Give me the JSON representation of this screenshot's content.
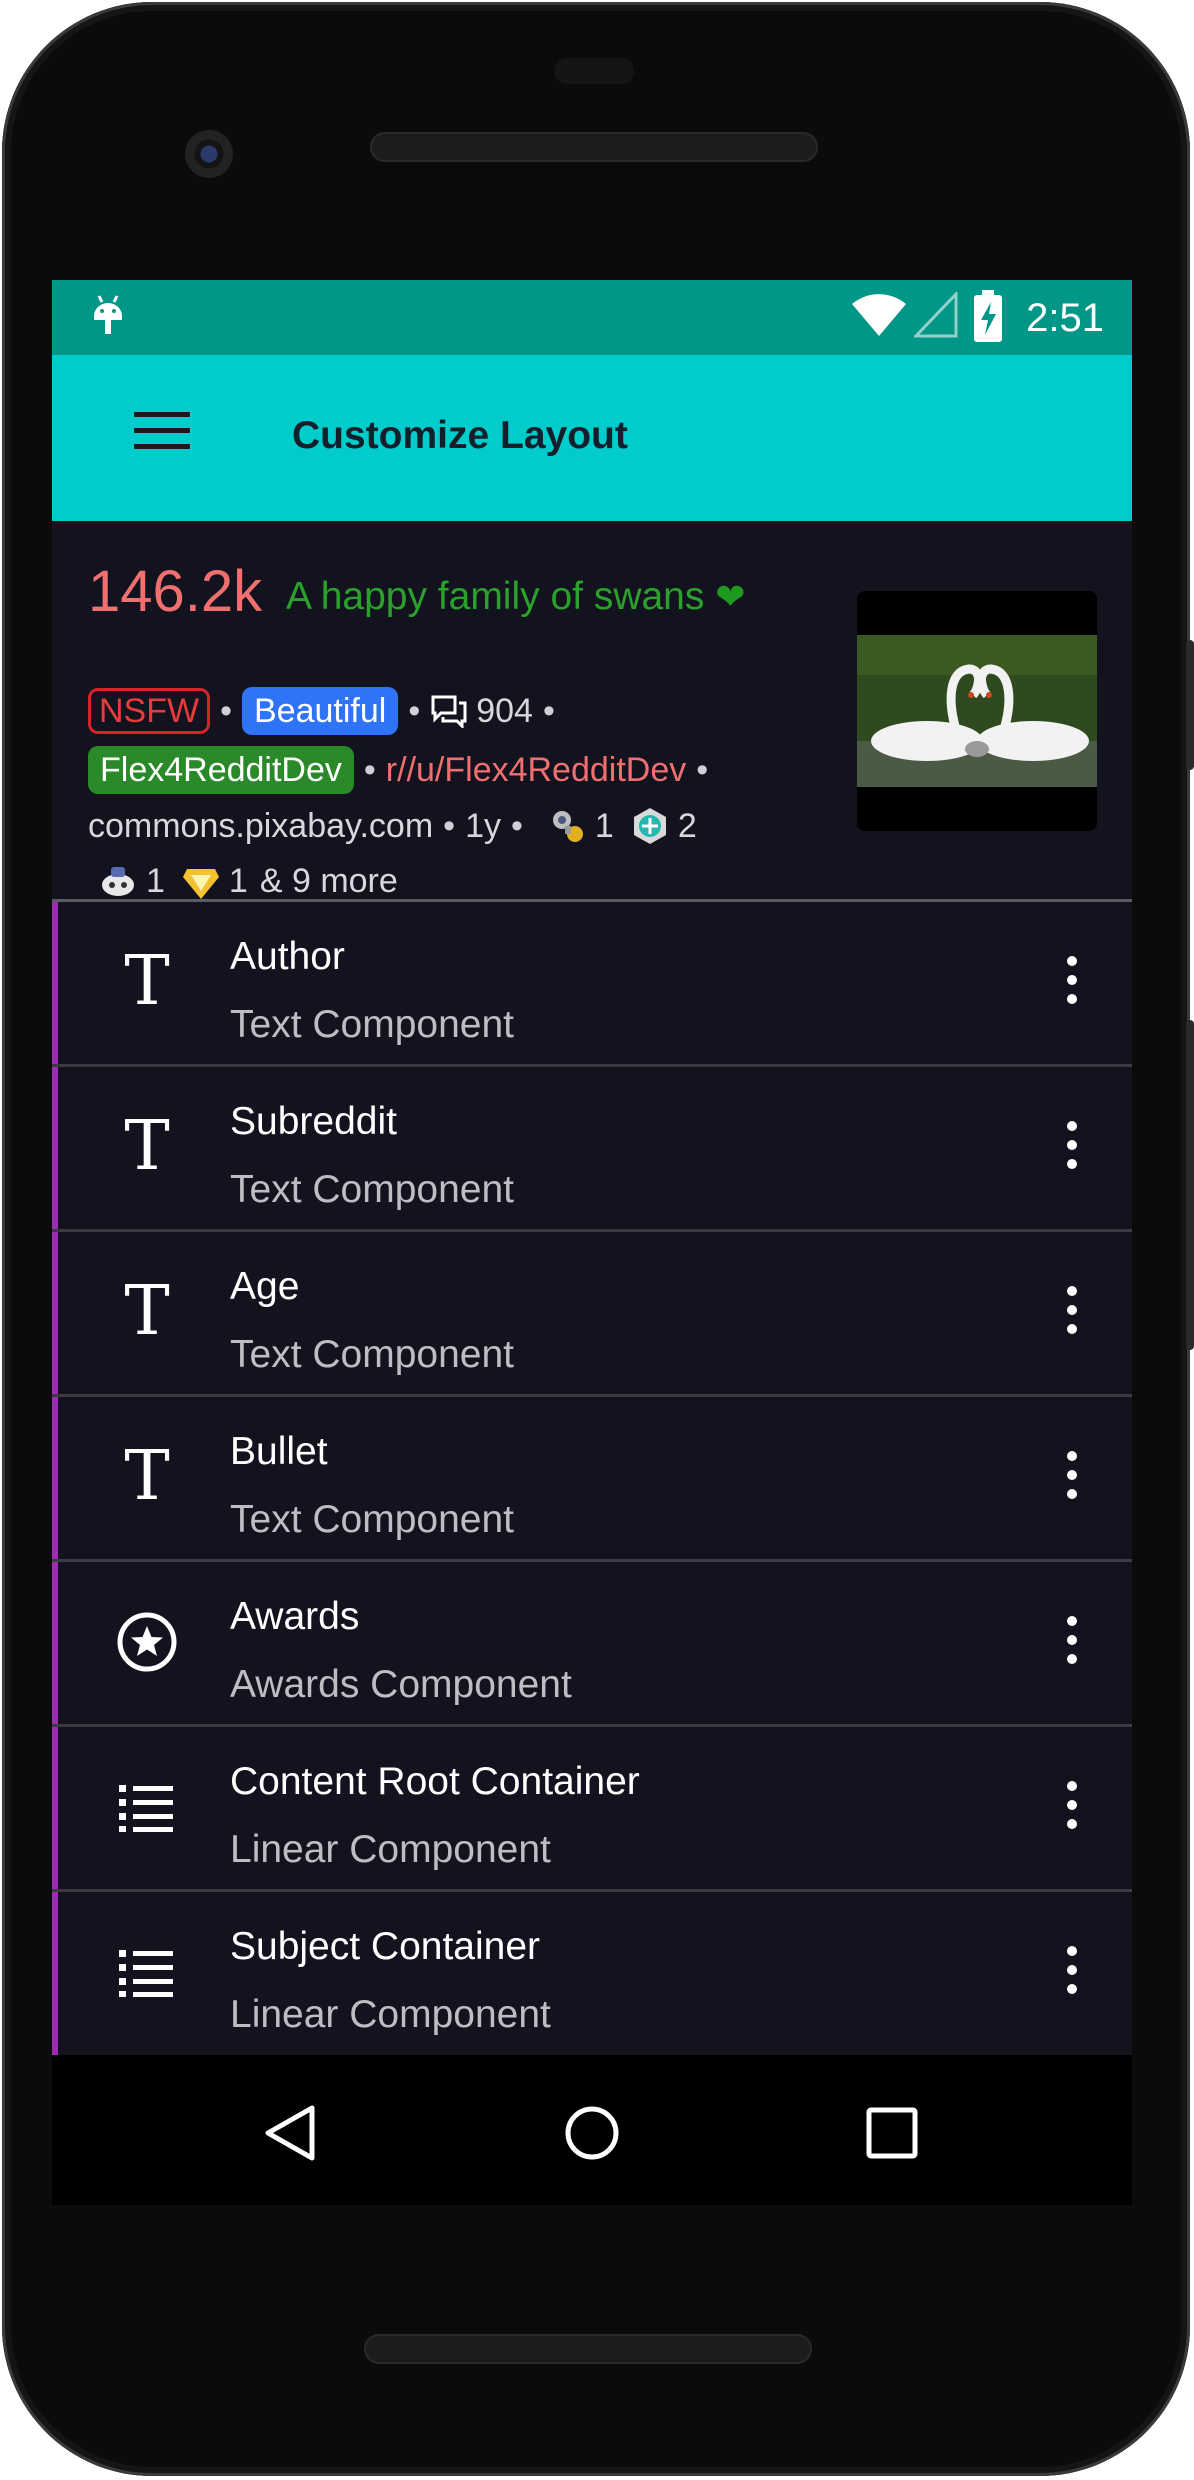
{
  "status_bar": {
    "time": "2:51",
    "icons": [
      "android-debug-icon",
      "wifi-icon",
      "cell-signal-icon",
      "battery-charging-icon"
    ]
  },
  "app_bar": {
    "title": "Customize Layout",
    "menu_icon": "hamburger-menu-icon"
  },
  "preview": {
    "score": "146.2k",
    "title": "A happy family of swans",
    "title_emoji": "❤",
    "flairs": {
      "nsfw": "NSFW",
      "link_flair": "Beautiful"
    },
    "comments": "904",
    "author_flair": "Flex4RedditDev",
    "subreddit": "r//u/Flex4RedditDev",
    "domain": "commons.pixabay.com",
    "age": "1y",
    "awards": [
      {
        "icon": "award-rocket-icon",
        "count": "1"
      },
      {
        "icon": "award-medal-icon",
        "count": "2"
      },
      {
        "icon": "award-robot-icon",
        "count": "1"
      },
      {
        "icon": "award-diamond-icon",
        "count": "1"
      }
    ],
    "more": "& 9 more",
    "bullet": "•"
  },
  "components": [
    {
      "title": "Author",
      "subtitle": "Text Component",
      "icon": "text-t-icon"
    },
    {
      "title": "Subreddit",
      "subtitle": "Text Component",
      "icon": "text-t-icon"
    },
    {
      "title": "Age",
      "subtitle": "Text Component",
      "icon": "text-t-icon"
    },
    {
      "title": "Bullet",
      "subtitle": "Text Component",
      "icon": "text-t-icon"
    },
    {
      "title": "Awards",
      "subtitle": "Awards Component",
      "icon": "star-circle-icon"
    },
    {
      "title": "Content Root Container",
      "subtitle": "Linear Component",
      "icon": "list-icon"
    },
    {
      "title": "Subject Container",
      "subtitle": "Linear Component",
      "icon": "list-icon"
    }
  ],
  "colors": {
    "status_bar": "#009688",
    "app_bar": "#00cccc",
    "background": "#13121f",
    "accent_bar": "#9a2fb0",
    "score": "#f07070",
    "title": "#2aa12a",
    "nsfw": "#d8232a",
    "link_flair": "#2f73f6",
    "author_flair": "#2a8a2a"
  },
  "nav_bar": {
    "icons": [
      "back-triangle-icon",
      "home-circle-icon",
      "recents-square-icon"
    ]
  }
}
